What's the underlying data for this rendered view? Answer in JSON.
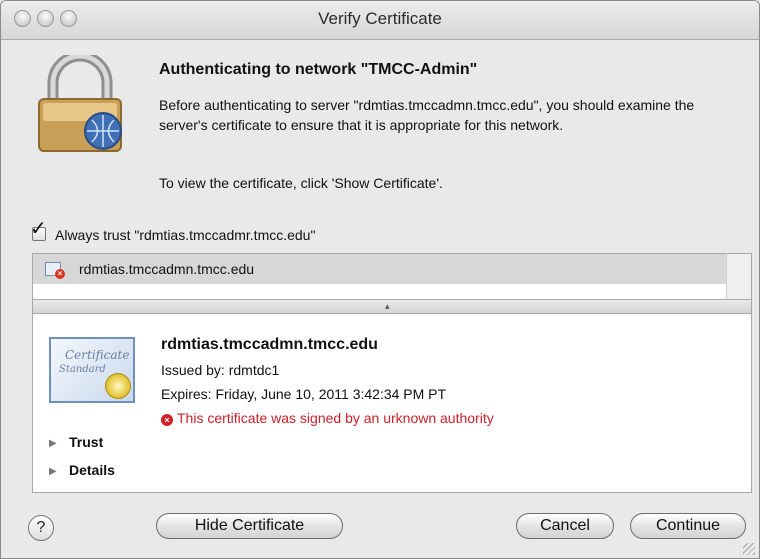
{
  "window": {
    "title": "Verify Certificate"
  },
  "header": {
    "heading": "Authenticating to network \"TMCC-Admin\"",
    "paragraph": "Before authenticating to server \"rdmtias.tmccadmn.tmcc.edu\", you should examine the server's certificate to ensure that it is appropriate for this network.",
    "instruction": "To view the certificate, click 'Show Certificate'."
  },
  "trust_checkbox": {
    "checked": true,
    "label": "Always trust \"rdmtias.tmccadmr.tmcc.edu\""
  },
  "cert_list": {
    "items": [
      {
        "label": "rdmtias.tmccadmn.tmcc.edu",
        "icon": "certificate-error-icon"
      }
    ]
  },
  "cert_detail": {
    "badge_line1": "Certificate",
    "badge_line2": "Standard",
    "name": "rdmtias.tmccadmn.tmcc.edu",
    "issued_by": "Issued by: rdmtdc1",
    "expires": "Expires: Friday, June 10, 2011 3:42:34 PM PT",
    "error": "This certificate was signed by an urknown authority",
    "error_color": "#d0202a",
    "sections": [
      "Trust",
      "Details"
    ]
  },
  "buttons": {
    "help": "?",
    "hide_certificate": "Hide Certificate",
    "cancel": "Cancel",
    "continue": "Continue"
  }
}
